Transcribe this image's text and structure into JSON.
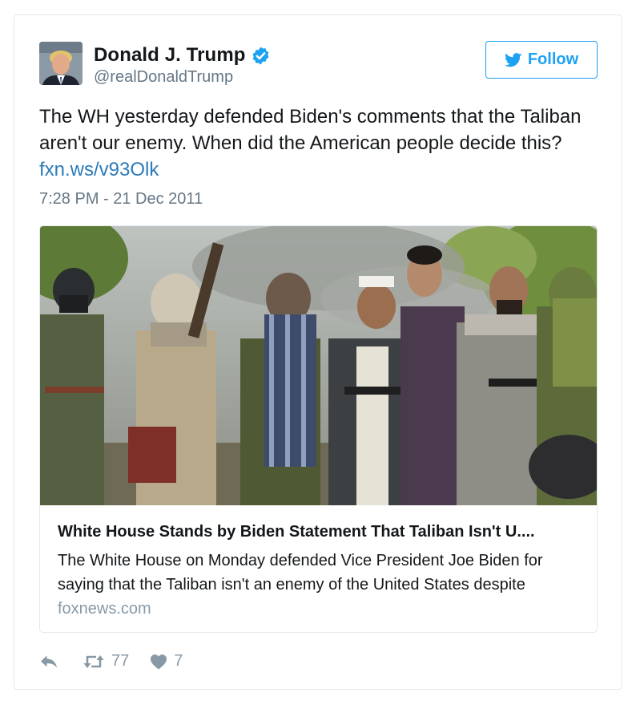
{
  "author": {
    "display_name": "Donald J. Trump",
    "handle": "@realDonaldTrump",
    "verified": true
  },
  "follow_button": {
    "label": "Follow"
  },
  "tweet": {
    "text": "The WH yesterday defended Biden's comments that the Taliban aren't our enemy. When did the American people decide this?",
    "link": "fxn.ws/v93Olk",
    "timestamp": "7:28 PM - 21 Dec 2011"
  },
  "card": {
    "title": "White House Stands by Biden Statement That Taliban Isn't U....",
    "description": "The White House on Monday defended Vice President Joe Biden for saying that the Taliban isn't an enemy of the United States despite",
    "domain": "foxnews.com"
  },
  "actions": {
    "retweet_count": "77",
    "like_count": "7"
  },
  "colors": {
    "accent": "#1da1f2",
    "link": "#2b7bb9",
    "muted": "#657786",
    "border": "#e1e8ed"
  },
  "icons": [
    "verified-badge-icon",
    "twitter-bird-icon",
    "reply-icon",
    "retweet-icon",
    "heart-icon"
  ]
}
